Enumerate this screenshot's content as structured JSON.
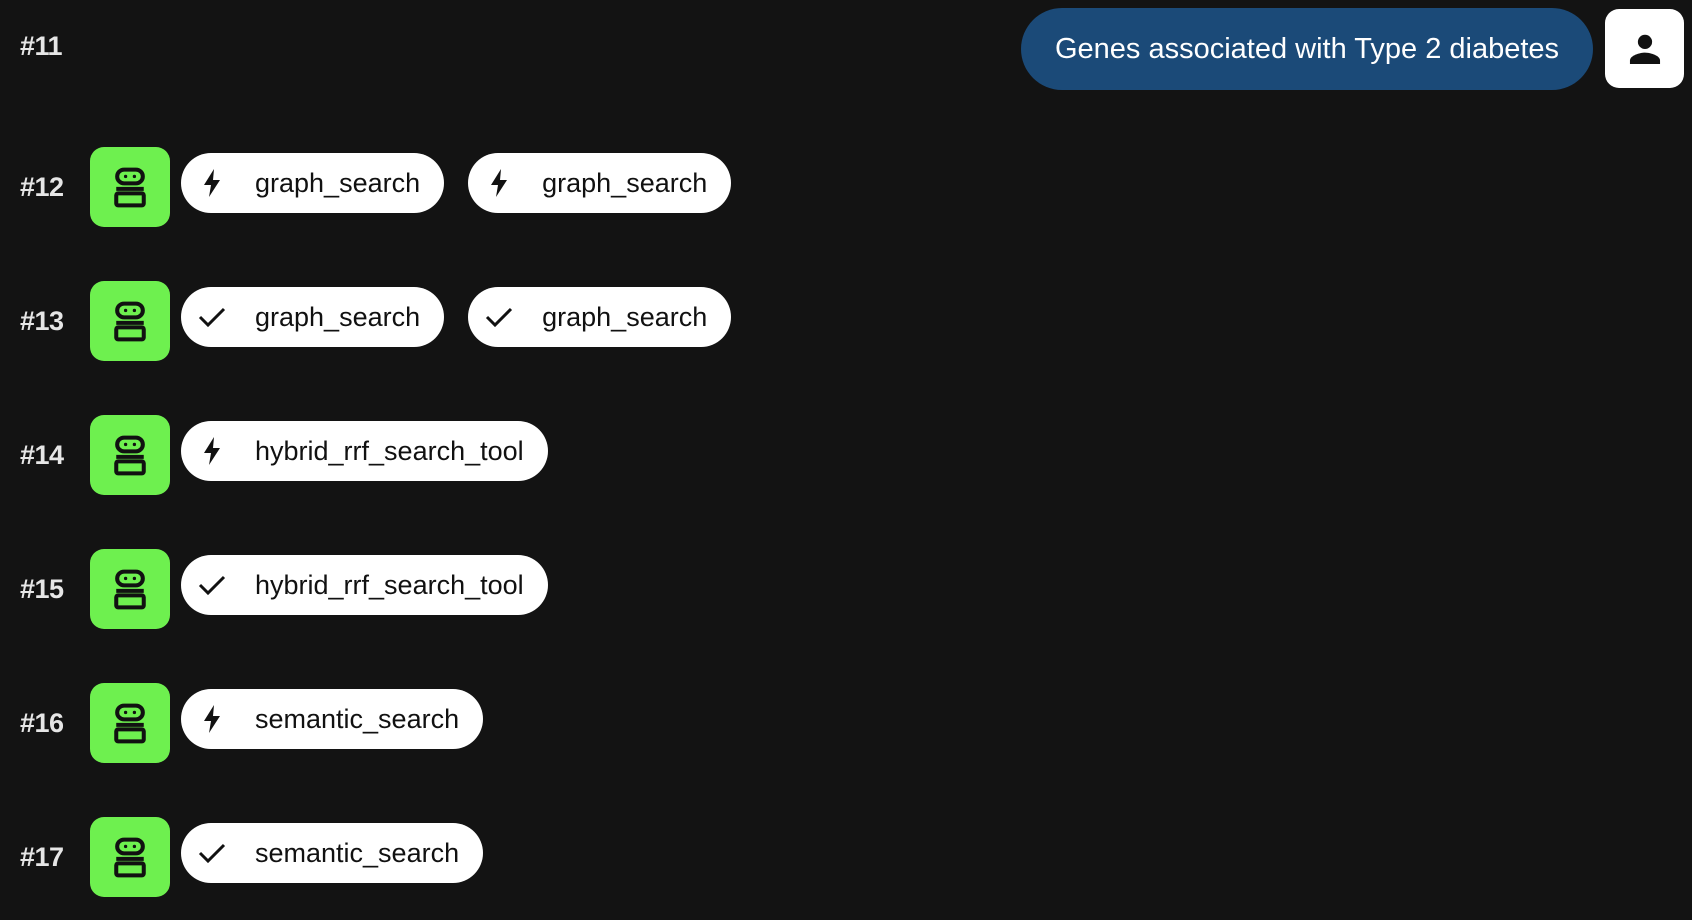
{
  "colors": {
    "background": "#131313",
    "bot_avatar": "#6ef04f",
    "user_bubble": "#1b4a78",
    "chip_background": "#ffffff",
    "chip_text": "#111111"
  },
  "user_message": {
    "number": "#11",
    "text": "Genes associated with Type 2 diabetes",
    "avatar_icon": "person-icon"
  },
  "bot_turns": [
    {
      "number": "#12",
      "avatar_icon": "robot-icon",
      "chips": [
        {
          "icon": "bolt-icon",
          "label": "graph_search"
        },
        {
          "icon": "bolt-icon",
          "label": "graph_search"
        }
      ]
    },
    {
      "number": "#13",
      "avatar_icon": "robot-icon",
      "chips": [
        {
          "icon": "check-icon",
          "label": "graph_search"
        },
        {
          "icon": "check-icon",
          "label": "graph_search"
        }
      ]
    },
    {
      "number": "#14",
      "avatar_icon": "robot-icon",
      "chips": [
        {
          "icon": "bolt-icon",
          "label": "hybrid_rrf_search_tool"
        }
      ]
    },
    {
      "number": "#15",
      "avatar_icon": "robot-icon",
      "chips": [
        {
          "icon": "check-icon",
          "label": "hybrid_rrf_search_tool"
        }
      ]
    },
    {
      "number": "#16",
      "avatar_icon": "robot-icon",
      "chips": [
        {
          "icon": "bolt-icon",
          "label": "semantic_search"
        }
      ]
    },
    {
      "number": "#17",
      "avatar_icon": "robot-icon",
      "chips": [
        {
          "icon": "check-icon",
          "label": "semantic_search"
        }
      ]
    }
  ]
}
